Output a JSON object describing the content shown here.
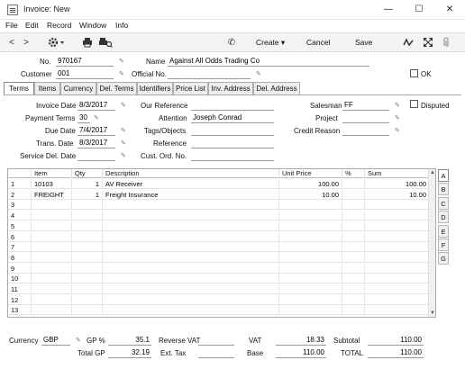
{
  "window": {
    "title": "Invoice: New",
    "minimize": "—",
    "maximize": "☐",
    "close": "✕"
  },
  "menu": [
    "File",
    "Edit",
    "Record",
    "Window",
    "Info"
  ],
  "toolbar": {
    "prev": "<",
    "next": ">",
    "phone": "✆",
    "create": "Create ▾",
    "cancel": "Cancel",
    "save": "Save"
  },
  "header": {
    "no_label": "No.",
    "no_value": "970167",
    "name_label": "Name",
    "name_value": "Against All Odds Trading Co",
    "customer_label": "Customer",
    "customer_value": "001",
    "official_label": "Official No.",
    "official_value": "",
    "ok_label": "OK"
  },
  "tabs": [
    "Terms",
    "Items",
    "Currency",
    "Del. Terms",
    "Identifiers",
    "Price List",
    "Inv. Address",
    "Del. Address"
  ],
  "terms": {
    "invoice_date_label": "Invoice Date",
    "invoice_date": "8/3/2017",
    "our_ref_label": "Our Reference",
    "our_ref": "",
    "salesman_label": "Salesman",
    "salesman": "FF",
    "disputed_label": "Disputed",
    "pay_terms_label": "Payment Terms",
    "pay_terms": "30",
    "attention_label": "Attention",
    "attention": "Joseph Conrad",
    "project_label": "Project",
    "project": "",
    "due_date_label": "Due Date",
    "due_date": "7/4/2017",
    "tags_label": "Tags/Objects",
    "tags": "",
    "credit_reason_label": "Credit Reason",
    "credit_reason": "",
    "trans_date_label": "Trans. Date",
    "trans_date": "8/3/2017",
    "reference_label": "Reference",
    "reference": "",
    "service_del_label": "Service Del. Date",
    "service_del": "",
    "cust_ord_label": "Cust. Ord. No.",
    "cust_ord": ""
  },
  "grid": {
    "headers": [
      "",
      "Item",
      "Qty",
      "Description",
      "Unit Price",
      "%",
      "Sum"
    ],
    "rows": [
      [
        "1",
        "10103",
        "1",
        "AV Receiver",
        "100.00",
        "",
        "100.00"
      ],
      [
        "2",
        "FREIGHT",
        "1",
        "Freight Insurance",
        "10.00",
        "",
        "10.00"
      ],
      [
        "3",
        "",
        "",
        "",
        "",
        "",
        ""
      ],
      [
        "4",
        "",
        "",
        "",
        "",
        "",
        ""
      ],
      [
        "5",
        "",
        "",
        "",
        "",
        "",
        ""
      ],
      [
        "6",
        "",
        "",
        "",
        "",
        "",
        ""
      ],
      [
        "7",
        "",
        "",
        "",
        "",
        "",
        ""
      ],
      [
        "8",
        "",
        "",
        "",
        "",
        "",
        ""
      ],
      [
        "9",
        "",
        "",
        "",
        "",
        "",
        ""
      ],
      [
        "10",
        "",
        "",
        "",
        "",
        "",
        ""
      ],
      [
        "11",
        "",
        "",
        "",
        "",
        "",
        ""
      ],
      [
        "12",
        "",
        "",
        "",
        "",
        "",
        ""
      ],
      [
        "13",
        "",
        "",
        "",
        "",
        "",
        ""
      ]
    ],
    "side_tabs": [
      "A",
      "B",
      "C",
      "D",
      "E",
      "F",
      "G"
    ]
  },
  "footer": {
    "currency_label": "Currency",
    "currency": "GBP",
    "gp_pct_label": "GP %",
    "gp_pct": "35.1",
    "reverse_vat_label": "Reverse VAT",
    "reverse_vat": "",
    "vat_label": "VAT",
    "vat": "18.33",
    "subtotal_label": "Subtotal",
    "subtotal": "110.00",
    "total_gp_label": "Total GP",
    "total_gp": "32.19",
    "ext_tax_label": "Ext. Tax",
    "ext_tax": "",
    "base_label": "Base",
    "base": "110.00",
    "total_label": "TOTAL",
    "total": "110.00"
  }
}
